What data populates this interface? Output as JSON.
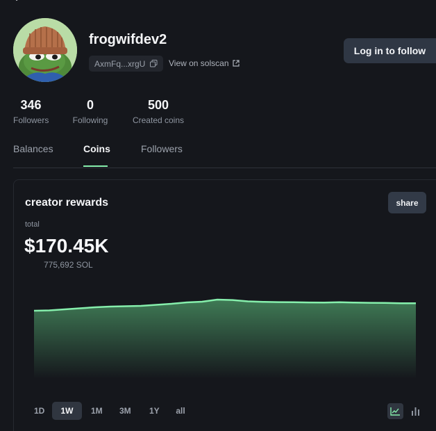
{
  "profile": {
    "username": "frogwifdev2",
    "address_short": "AxmFq...xrgU",
    "solscan_label": "View on solscan",
    "login_label": "Log in to follow"
  },
  "stats": [
    {
      "value": "346",
      "label": "Followers"
    },
    {
      "value": "0",
      "label": "Following"
    },
    {
      "value": "500",
      "label": "Created coins"
    }
  ],
  "tabs": [
    {
      "label": "Balances",
      "active": false
    },
    {
      "label": "Coins",
      "active": true
    },
    {
      "label": "Followers",
      "active": false
    }
  ],
  "rewards": {
    "title": "creator rewards",
    "share_label": "share",
    "total_label": "total",
    "total_value": "$170.45K",
    "sol_value": "775,692 SOL"
  },
  "ranges": [
    {
      "label": "1D",
      "active": false
    },
    {
      "label": "1W",
      "active": true
    },
    {
      "label": "1M",
      "active": false
    },
    {
      "label": "3M",
      "active": false
    },
    {
      "label": "1Y",
      "active": false
    },
    {
      "label": "all",
      "active": false
    }
  ],
  "view_toggle": {
    "line_active": true,
    "bar_active": false
  },
  "colors": {
    "accent": "#86efac",
    "chart_fill_top": "#3f7a55",
    "background": "#15171c"
  },
  "chart_data": {
    "type": "area",
    "points": [
      0,
      0.5,
      2,
      3.5,
      5,
      6,
      6.5,
      7,
      8.5,
      10,
      12,
      13,
      16,
      15.4,
      13.5,
      12.8,
      12.4,
      12.2,
      11.9,
      11.7,
      12.2,
      11.7,
      11.4,
      11.3,
      10.8,
      10.8
    ]
  }
}
